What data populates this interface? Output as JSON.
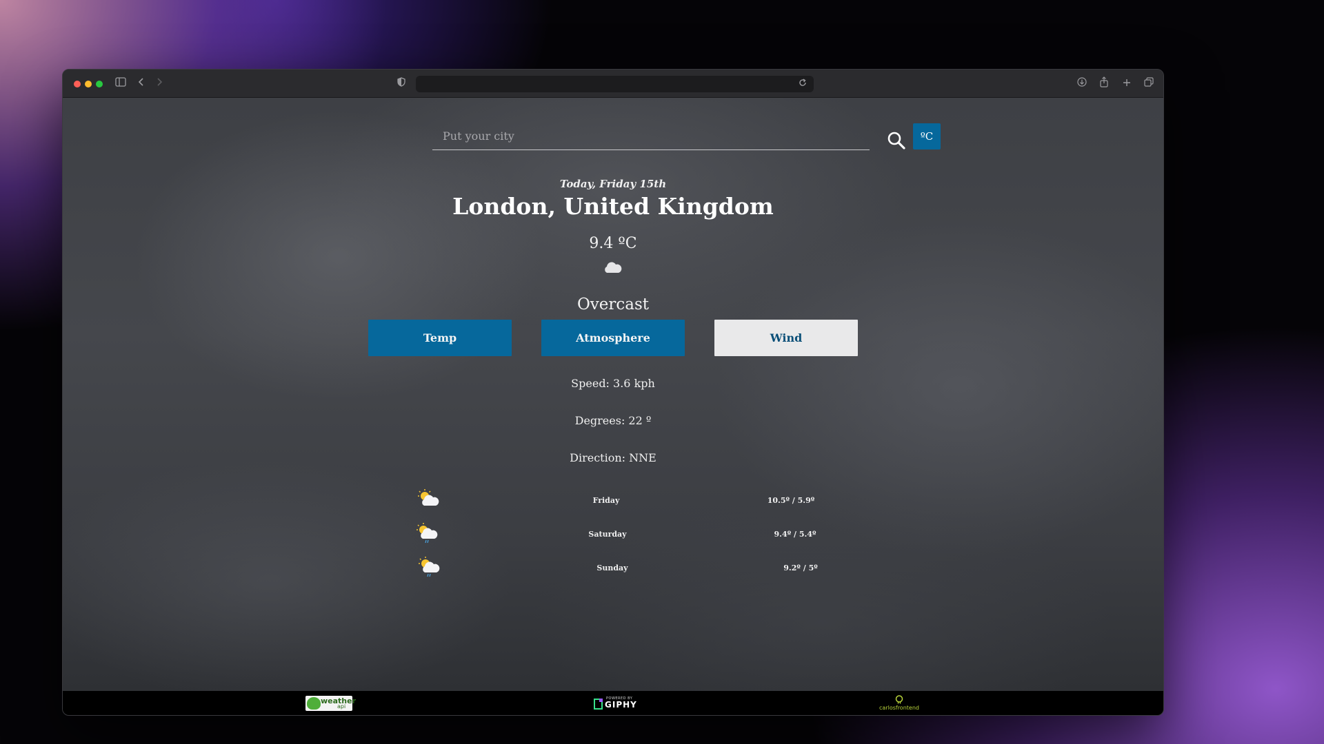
{
  "search": {
    "placeholder": "Put your city"
  },
  "unit_toggle": {
    "label": "ºC"
  },
  "weather": {
    "date": "Today, Friday 15th",
    "location": "London, United Kingdom",
    "temperature": "9.4 ºC",
    "condition": "Overcast",
    "condition_icon": "cloud-icon"
  },
  "tabs": [
    {
      "label": "Temp",
      "active": false
    },
    {
      "label": "Atmosphere",
      "active": false
    },
    {
      "label": "Wind",
      "active": true
    }
  ],
  "wind": {
    "speed": "Speed: 3.6 kph",
    "degrees": "Degrees: 22 º",
    "direction": "Direction: NNE"
  },
  "forecast": [
    {
      "day": "Friday",
      "range": "10.5º / 5.9º",
      "icon": "partly-cloudy-icon"
    },
    {
      "day": "Saturday",
      "range": "9.4º / 5.4º",
      "icon": "sun-cloud-rain-icon"
    },
    {
      "day": "Sunday",
      "range": "9.2º / 5º",
      "icon": "sun-cloud-rain-icon"
    }
  ],
  "footer": {
    "weatherapi_logo": {
      "title": "weather",
      "subtitle": "api"
    },
    "giphy_logo": {
      "tagline": "POWERED BY",
      "name": "GIPHY"
    },
    "author_logo": {
      "text": "carlosfrontend"
    }
  },
  "colors": {
    "accent": "#06689c",
    "tab_inactive_bg": "#e9e9ea",
    "footer_bg": "#000000"
  }
}
